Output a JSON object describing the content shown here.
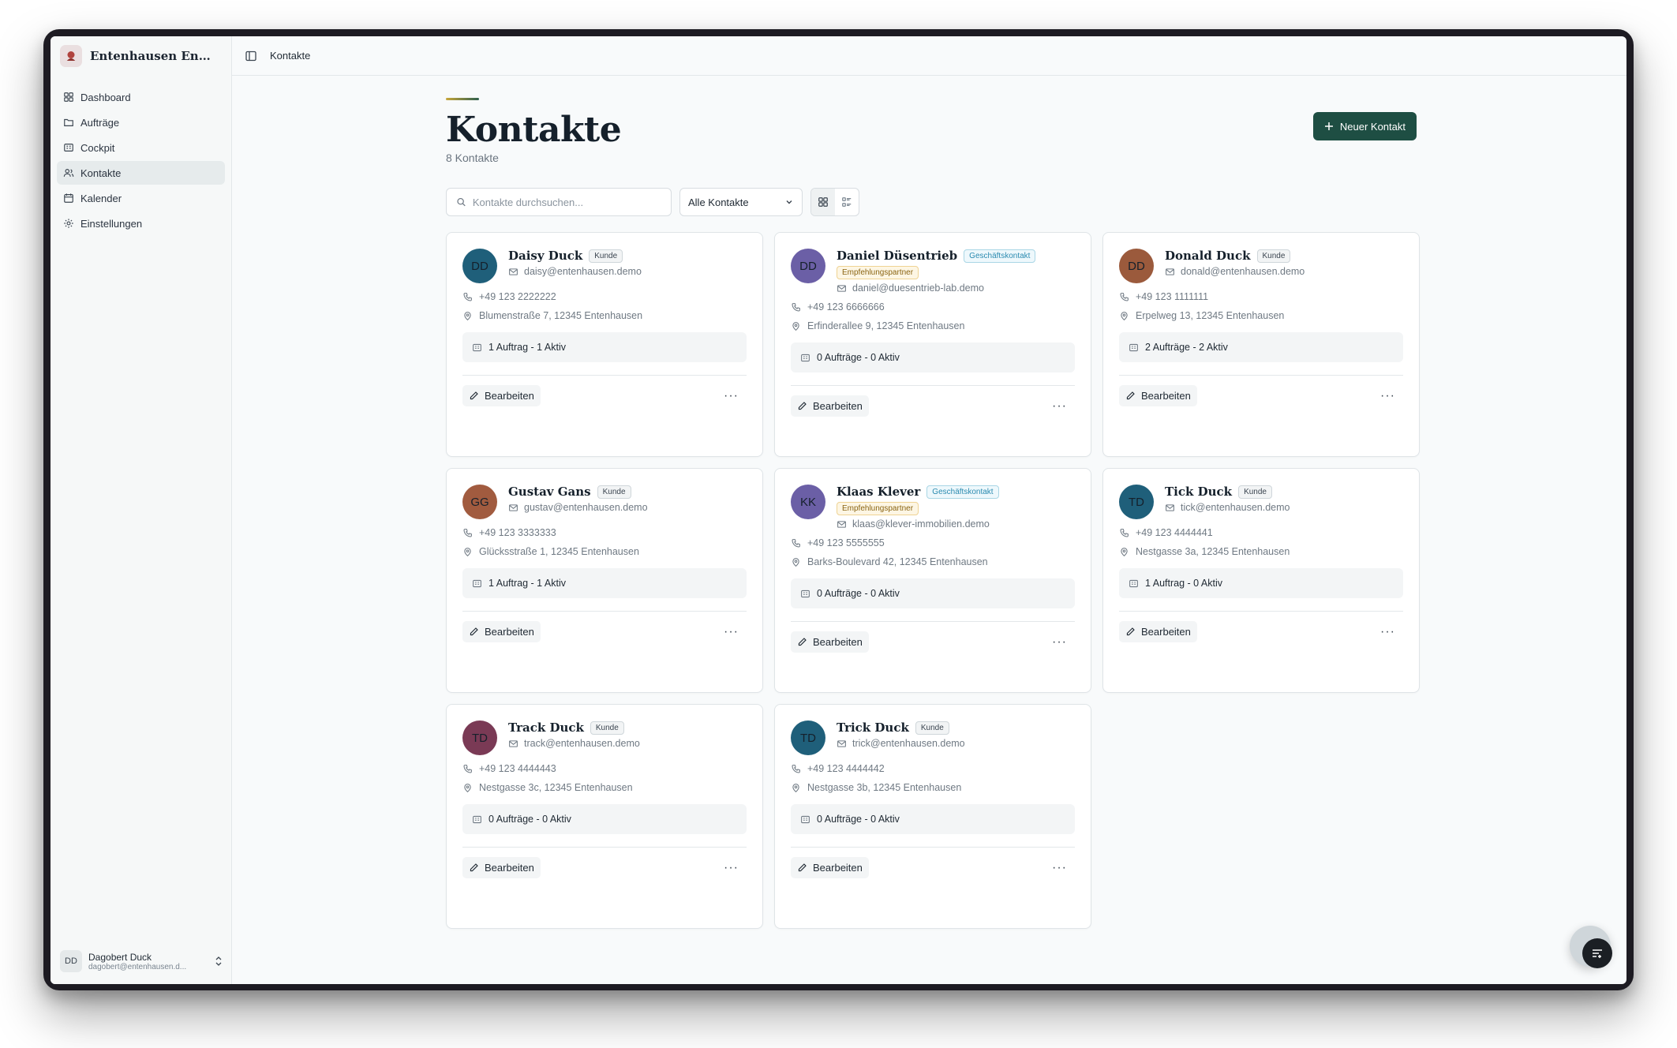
{
  "app": {
    "brand_name": "Entenhausen Energi...",
    "brand_color": "#b0433e",
    "accent_color": "#1e4e43"
  },
  "sidebar": {
    "items": [
      {
        "label": "Dashboard",
        "icon": "dashboard-icon"
      },
      {
        "label": "Aufträge",
        "icon": "folder-icon"
      },
      {
        "label": "Cockpit",
        "icon": "building-icon"
      },
      {
        "label": "Kontakte",
        "icon": "users-icon",
        "active": true
      },
      {
        "label": "Kalender",
        "icon": "calendar-icon"
      },
      {
        "label": "Einstellungen",
        "icon": "gear-icon"
      }
    ],
    "user": {
      "initials": "DD",
      "name": "Dagobert Duck",
      "email": "dagobert@entenhausen.d..."
    }
  },
  "topbar": {
    "title": "Kontakte"
  },
  "page": {
    "title": "Kontakte",
    "subtitle": "8 Kontakte",
    "new_button": "Neuer Kontakt",
    "search_placeholder": "Kontakte durchsuchen...",
    "filter_value": "Alle Kontakte"
  },
  "contacts": [
    {
      "initials": "DD",
      "avatar_color": "#1f5f7a",
      "name": "Daisy Duck",
      "badges": [
        "Kunde"
      ],
      "email": "daisy@entenhausen.demo",
      "phone": "+49 123 2222222",
      "address": "Blumenstraße 7, 12345 Entenhausen",
      "orders": "1 Auftrag - 1 Aktiv",
      "edit": "Bearbeiten"
    },
    {
      "initials": "DD",
      "avatar_color": "#6b5fa6",
      "name": "Daniel Düsentrieb",
      "badges": [
        "Geschäftskontakt",
        "Empfehlungspartner"
      ],
      "email": "daniel@duesentrieb-lab.demo",
      "phone": "+49 123 6666666",
      "address": "Erfinderallee 9, 12345 Entenhausen",
      "orders": "0 Aufträge - 0 Aktiv",
      "edit": "Bearbeiten"
    },
    {
      "initials": "DD",
      "avatar_color": "#9b5a3c",
      "name": "Donald Duck",
      "badges": [
        "Kunde"
      ],
      "email": "donald@entenhausen.demo",
      "phone": "+49 123 1111111",
      "address": "Erpelweg 13, 12345 Entenhausen",
      "orders": "2 Aufträge - 2 Aktiv",
      "edit": "Bearbeiten"
    },
    {
      "initials": "GG",
      "avatar_color": "#a15b3f",
      "name": "Gustav Gans",
      "badges": [
        "Kunde"
      ],
      "email": "gustav@entenhausen.demo",
      "phone": "+49 123 3333333",
      "address": "Glücksstraße 1, 12345 Entenhausen",
      "orders": "1 Auftrag - 1 Aktiv",
      "edit": "Bearbeiten"
    },
    {
      "initials": "KK",
      "avatar_color": "#6b5fa6",
      "name": "Klaas Klever",
      "badges": [
        "Geschäftskontakt",
        "Empfehlungspartner"
      ],
      "email": "klaas@klever-immobilien.demo",
      "phone": "+49 123 5555555",
      "address": "Barks-Boulevard 42, 12345 Entenhausen",
      "orders": "0 Aufträge - 0 Aktiv",
      "edit": "Bearbeiten"
    },
    {
      "initials": "TD",
      "avatar_color": "#1f5f7a",
      "name": "Tick Duck",
      "badges": [
        "Kunde"
      ],
      "email": "tick@entenhausen.demo",
      "phone": "+49 123 4444441",
      "address": "Nestgasse 3a, 12345 Entenhausen",
      "orders": "1 Auftrag - 0 Aktiv",
      "edit": "Bearbeiten"
    },
    {
      "initials": "TD",
      "avatar_color": "#7a3a55",
      "name": "Track Duck",
      "badges": [
        "Kunde"
      ],
      "email": "track@entenhausen.demo",
      "phone": "+49 123 4444443",
      "address": "Nestgasse 3c, 12345 Entenhausen",
      "orders": "0 Aufträge - 0 Aktiv",
      "edit": "Bearbeiten"
    },
    {
      "initials": "TD",
      "avatar_color": "#1f5f7a",
      "name": "Trick Duck",
      "badges": [
        "Kunde"
      ],
      "email": "trick@entenhausen.demo",
      "phone": "+49 123 4444442",
      "address": "Nestgasse 3b, 12345 Entenhausen",
      "orders": "0 Aufträge - 0 Aktiv",
      "edit": "Bearbeiten"
    }
  ]
}
